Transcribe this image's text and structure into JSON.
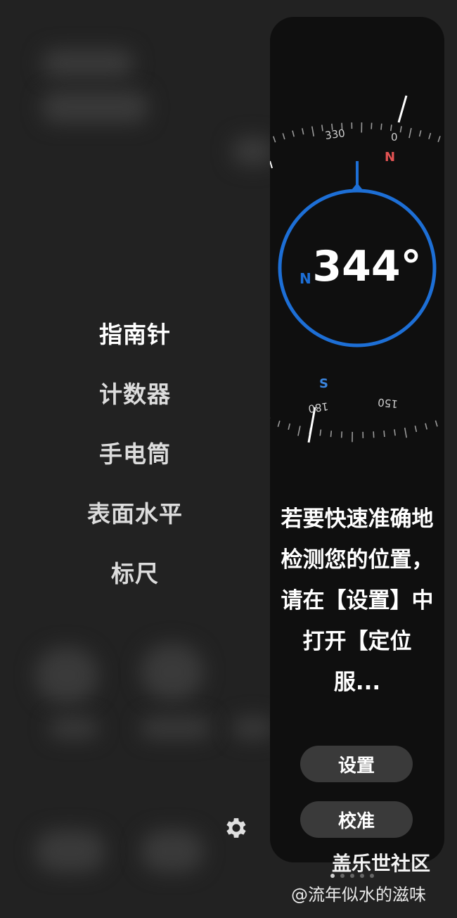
{
  "menu": {
    "items": [
      {
        "label": "指南针",
        "active": true
      },
      {
        "label": "计数器",
        "active": false
      },
      {
        "label": "手电筒",
        "active": false
      },
      {
        "label": "表面水平",
        "active": false
      },
      {
        "label": "标尺",
        "active": false
      }
    ]
  },
  "compass": {
    "heading": "344°",
    "ticks": {
      "t330": "330",
      "t0": "0",
      "t180": "180",
      "t150": "150"
    },
    "north_letter": "N",
    "south_letter": "S",
    "inner_letter": "N",
    "colors": {
      "ring": "#1d6fd6",
      "north": "#e25353",
      "south": "#3b86e0"
    }
  },
  "message": "若要快速准确地检测您的位置，请在【设置】中打开【定位服...",
  "buttons": {
    "settings": "设置",
    "calibrate": "校准"
  },
  "pager": {
    "count": 5,
    "active_index": 0
  },
  "watermark": {
    "site": "盖乐世社区",
    "author": "@流年似水的滋味"
  },
  "icons": {
    "settings": "gear-icon"
  }
}
